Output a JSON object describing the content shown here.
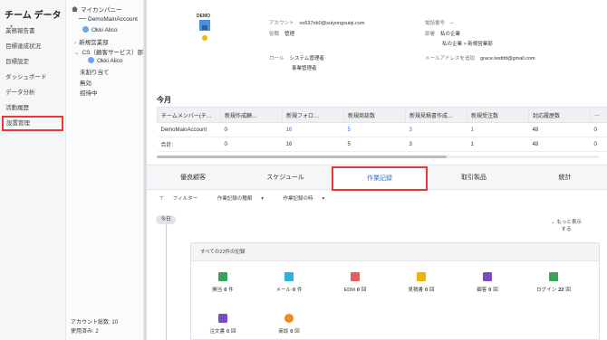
{
  "nav": {
    "title": "チーム データ",
    "items": [
      {
        "label": "業務報告書"
      },
      {
        "label": "目標達成状況"
      },
      {
        "label": "目標設定"
      },
      {
        "label": "ダッシュボード"
      },
      {
        "label": "データ分析"
      },
      {
        "label": "活動履歴"
      },
      {
        "label": "設置管理"
      }
    ]
  },
  "tree": {
    "root": "マイカンパニー",
    "nodes": [
      {
        "label": "DemoMainAccount"
      },
      {
        "label": "Okki Alico"
      },
      {
        "label": "新規営業部"
      },
      {
        "label": "CS（顧客サービス）部"
      },
      {
        "label": "Okki Alico"
      },
      {
        "label": "未割り当て"
      },
      {
        "label": "無効"
      },
      {
        "label": "招待中"
      }
    ],
    "footer_total": "アカウント総数:  10",
    "footer_used": "使用済み:  2"
  },
  "profile": {
    "logo_text": "DEMO",
    "account_label": "アカウント",
    "account_value": "vo637nb0@suiyongsuiqi.com",
    "role_label": "役職",
    "role_value": "管理",
    "role2_label": "ロール",
    "role2_value1": "システム管理者",
    "role2_value2": "事業管理者",
    "phone_label": "電話番号",
    "phone_value": "--",
    "dept_label": "部署",
    "dept_value1": "私の企業",
    "dept_value2": "私の企業 > 新規営業部",
    "email_label": "メールアドレスを追加",
    "email_value": "grace.testtttl@gmail.com"
  },
  "stats": {
    "section_title": "今月",
    "headers": [
      "チームメンバー(チ…",
      "新規作成顧…",
      "新規フォロ…",
      "新規商談数",
      "新規見積書作成…",
      "新規受注数",
      "封応履歴数",
      "…"
    ],
    "rows": [
      {
        "name": "DemoMainAccount",
        "c1": "0",
        "c2": "16",
        "c3": "5",
        "c4": "3",
        "c5": "1",
        "c6": "48",
        "c7": "0"
      },
      {
        "name": "合計:",
        "c1": "0",
        "c2": "16",
        "c3": "5",
        "c4": "3",
        "c5": "1",
        "c6": "48",
        "c7": "0"
      }
    ]
  },
  "tabs": [
    {
      "label": "優良顧客"
    },
    {
      "label": "スケジュール"
    },
    {
      "label": "作業記録"
    },
    {
      "label": "取引製品"
    },
    {
      "label": "統計"
    }
  ],
  "filters": {
    "filter": "フィルター",
    "by_type": "作業記録の種類",
    "by_time": "作業記録の時"
  },
  "timeline": {
    "today": "今日",
    "more": "もっと表示する"
  },
  "records": {
    "header": "すべての22件の記録",
    "items": [
      {
        "label": "開当",
        "count": "0",
        "unit": "件",
        "icon": "bookmark-icon",
        "color": "#3aa357"
      },
      {
        "label": "メール",
        "count": "0",
        "unit": "件",
        "icon": "mail-icon",
        "color": "#2bb3d8"
      },
      {
        "label": "EDM",
        "count": "0",
        "unit": "回",
        "icon": "edm-icon",
        "color": "#e35d5d"
      },
      {
        "label": "見積書",
        "count": "0",
        "unit": "回",
        "icon": "quote-icon",
        "color": "#f0b400"
      },
      {
        "label": "顧客",
        "count": "0",
        "unit": "回",
        "icon": "customer-icon",
        "color": "#7b4bc4"
      },
      {
        "label": "ログイン",
        "count": "22",
        "unit": "回",
        "icon": "login-icon",
        "color": "#3aa357"
      },
      {
        "label": "注文書",
        "count": "0",
        "unit": "回",
        "icon": "order-icon",
        "color": "#7b4bc4"
      },
      {
        "label": "商談",
        "count": "0",
        "unit": "回",
        "icon": "deal-icon",
        "color": "#f08c1a"
      }
    ]
  }
}
